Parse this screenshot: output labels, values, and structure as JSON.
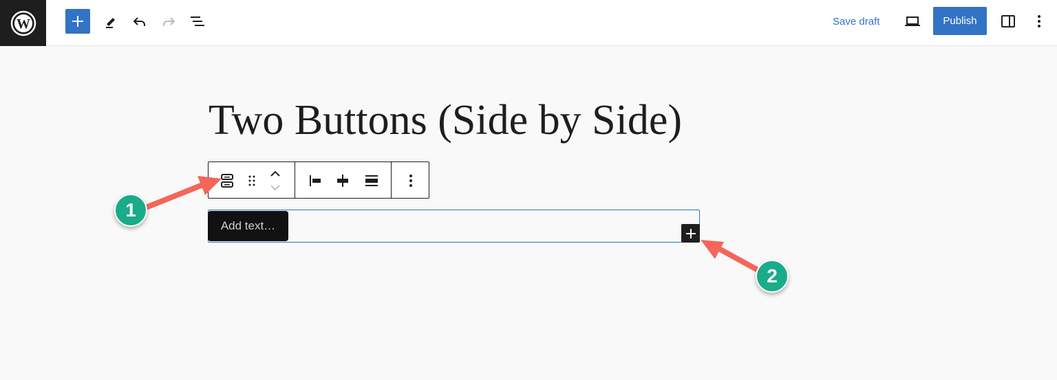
{
  "header": {
    "logo_icon": "wordpress-logo",
    "inserter_icon": "plus-icon",
    "tools": [
      "pencil-icon",
      "undo-icon",
      "redo-icon",
      "list-view-icon"
    ],
    "save_draft_label": "Save draft",
    "preview_icon": "laptop-icon",
    "publish_label": "Publish",
    "settings_icon": "sidebar-toggle-icon",
    "options_icon": "vertical-ellipsis-icon",
    "accent_color": "#3273c6"
  },
  "editor": {
    "post_title": "Two Buttons (Side by Side)",
    "block_toolbar": {
      "icons": [
        "buttons-block-icon",
        "drag-handle-icon",
        "move-up-icon",
        "move-down-icon",
        "justify-left-icon",
        "justify-center-icon",
        "justify-space-between-icon",
        "more-options-icon"
      ]
    },
    "button_placeholder": "Add text…",
    "appender_icon": "plus-icon"
  },
  "annotations": {
    "badge_1": "1",
    "badge_2": "2",
    "arrow_color": "#f4665a",
    "badge_color": "#1aab8a"
  }
}
